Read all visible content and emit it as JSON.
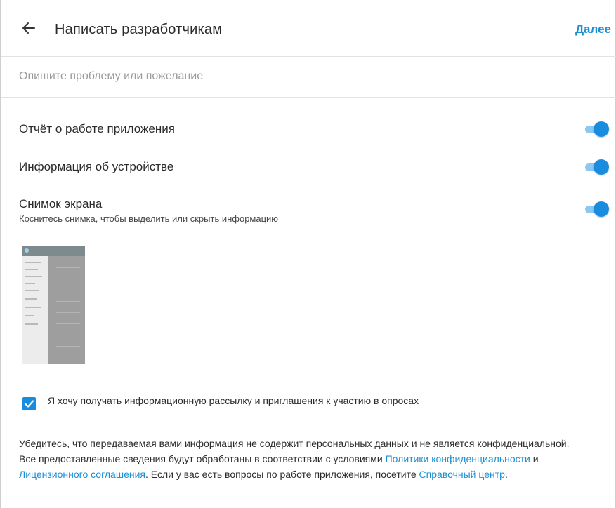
{
  "header": {
    "title": "Написать разработчикам",
    "next_label": "Далее"
  },
  "description": {
    "placeholder": "Опишите проблему или пожелание"
  },
  "options": [
    {
      "label": "Отчёт о работе приложения",
      "enabled": true
    },
    {
      "label": "Информация об устройстве",
      "enabled": true
    },
    {
      "label": "Снимок экрана",
      "sublabel": "Коснитесь снимка, чтобы выделить или скрыть информацию",
      "enabled": true
    }
  ],
  "newsletter": {
    "label": "Я хочу получать информационную рассылку и приглашения к участию в опросах",
    "checked": true
  },
  "notice": {
    "text_1": "Убедитесь, что передаваемая вами информация не содержит персональных данных и не является конфиденциальной. Все предоставленные сведения будут обработаны в соответствии с условиями ",
    "link_privacy": "Политики конфиденциальности",
    "text_2": " и ",
    "link_license": "Лицензионного соглашения",
    "text_3": ". Если у вас есть вопросы по работе приложения, посетите ",
    "link_help": "Справочный центр",
    "text_4": "."
  },
  "colors": {
    "accent": "#1a8ce0",
    "link": "#1a8fd3",
    "toggle_track": "#8cc8f0"
  },
  "icons": {
    "back": "arrow-left-icon",
    "check": "checkmark-icon"
  }
}
